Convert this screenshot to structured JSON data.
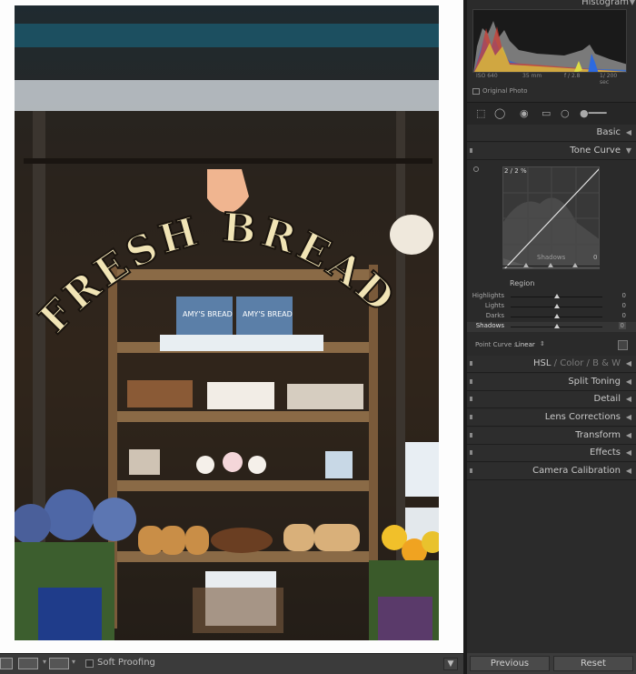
{
  "histogram": {
    "title": "Histogram",
    "iso": "ISO 640",
    "focal_length": "35 mm",
    "aperture": "f / 2.8",
    "shutter": "1/ 200 sec",
    "original_photo_label": "Original Photo"
  },
  "toolbar": {
    "soft_proofing_label": "Soft Proofing"
  },
  "sections": {
    "basic": "Basic",
    "tone_curve": "Tone Curve",
    "hsl": "HSL",
    "color": "Color",
    "bw": "B & W",
    "split_toning": "Split Toning",
    "detail": "Detail",
    "lens_corrections": "Lens Corrections",
    "transform": "Transform",
    "effects": "Effects",
    "camera_calibration": "Camera Calibration"
  },
  "tone_curve": {
    "readout": "2 / 2 %",
    "region_hover_label": "Shadows",
    "region_hover_value": "0",
    "region_title": "Region",
    "sliders": [
      {
        "label": "Highlights",
        "value": "0",
        "position": 0.5
      },
      {
        "label": "Lights",
        "value": "0",
        "position": 0.5
      },
      {
        "label": "Darks",
        "value": "0",
        "position": 0.5
      },
      {
        "label": "Shadows",
        "value": "0",
        "position": 0.5
      }
    ],
    "point_curve_label": "Point Curve :",
    "point_curve_value": "Linear"
  },
  "nav": {
    "previous": "Previous",
    "reset": "Reset"
  },
  "photo": {
    "sign_text": "FRESH BREAD",
    "box_label_1": "AMY'S BREAD",
    "box_label_2": "AMY'S BREAD"
  },
  "colors": {
    "panel_bg": "#2b2b2b",
    "sign_gold": "#f1e4b5"
  }
}
